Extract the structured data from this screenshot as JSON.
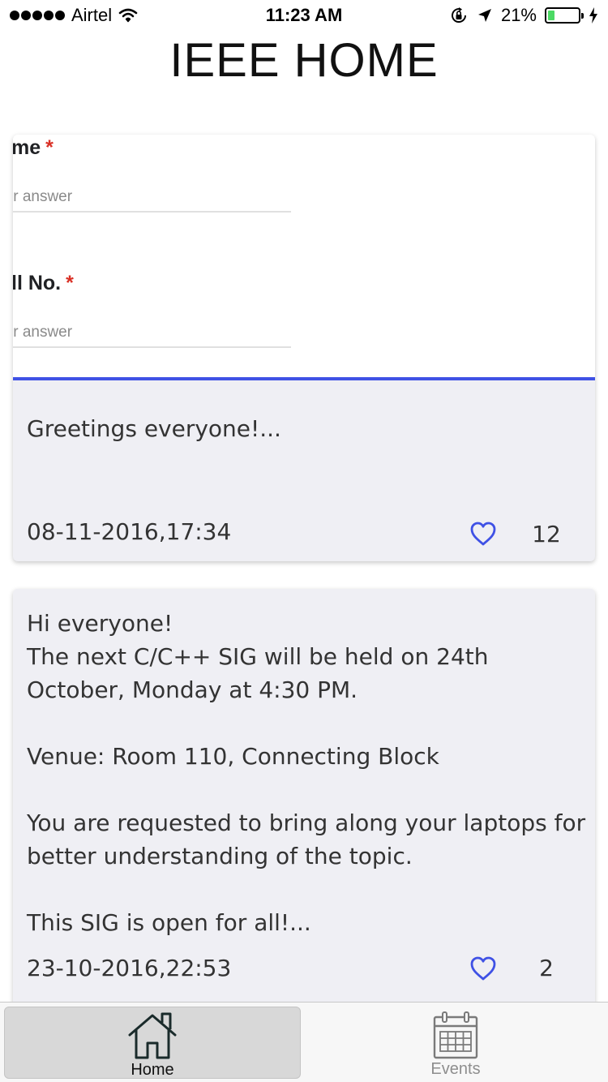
{
  "status_bar": {
    "carrier": "Airtel",
    "time": "11:23 AM",
    "battery_percent": "21%",
    "battery_level": 0.21,
    "icons": [
      "signal-dots-icon",
      "wifi-icon",
      "orientation-lock-icon",
      "location-arrow-icon",
      "battery-icon",
      "charging-bolt-icon"
    ]
  },
  "header": {
    "title": "IEEE HOME"
  },
  "posts": [
    {
      "image": {
        "fields": [
          {
            "label": "me",
            "required_mark": "*",
            "placeholder": "ir answer"
          },
          {
            "label": "ll No.",
            "required_mark": "*",
            "placeholder": "ir answer"
          }
        ]
      },
      "text": "Greetings everyone!...",
      "date": "08-11-2016,17:34",
      "likes": "12"
    },
    {
      "text": "Hi everyone!\nThe next C/C++ SIG will be held on 24th October, Monday at 4:30 PM.\n\nVenue: Room 110, Connecting Block\n\nYou are requested to bring along your laptops for better understanding of the topic.\n\nThis SIG is open for all!...",
      "date": "23-10-2016,22:53",
      "likes": "2"
    }
  ],
  "tab_bar": {
    "tabs": [
      {
        "label": "Home",
        "icon": "home-icon",
        "selected": true
      },
      {
        "label": "Events",
        "icon": "calendar-icon",
        "selected": false
      }
    ]
  },
  "colors": {
    "accent": "#3f51e5",
    "card_background": "#efeff4",
    "required": "#d93025",
    "battery": "#4cd964"
  }
}
